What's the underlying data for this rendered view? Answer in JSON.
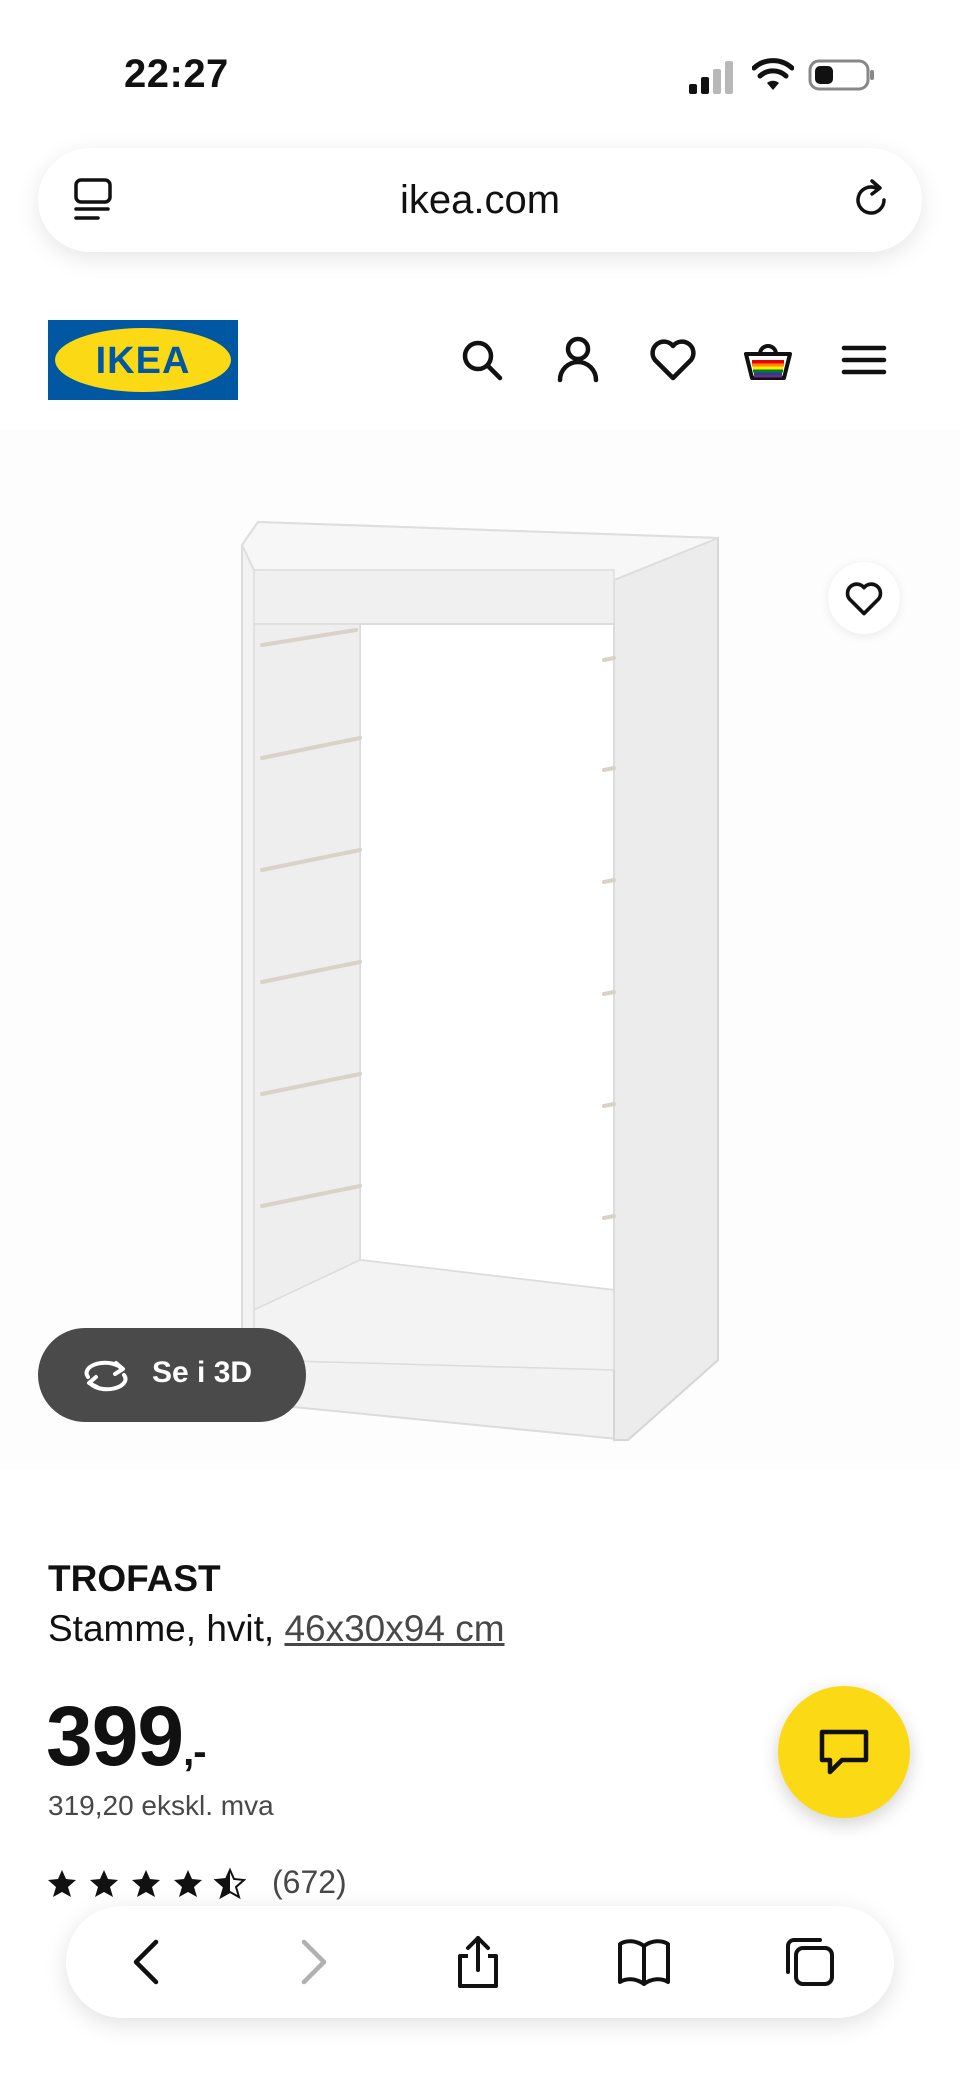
{
  "status_bar": {
    "time": "22:27"
  },
  "browser": {
    "url": "ikea.com"
  },
  "header": {
    "logo_text": "IKEA",
    "brand_blue": "#0058A3",
    "brand_yellow": "#FBD914"
  },
  "product": {
    "view_3d_label": "Se i 3D",
    "name": "TROFAST",
    "description_prefix": "Stamme, hvit, ",
    "dimensions": "46x30x94 cm",
    "price_main": "399",
    "price_suffix": ",-",
    "price_ex_vat": "319,20 ekskl. mva",
    "rating_stars": 4.5,
    "review_count": "(672)"
  },
  "icons": {
    "header": [
      "search-icon",
      "account-icon",
      "heart-icon",
      "shopping-bag-icon",
      "menu-icon"
    ],
    "toolbar": [
      "back-icon",
      "forward-icon",
      "share-icon",
      "bookmarks-icon",
      "tabs-icon"
    ]
  }
}
